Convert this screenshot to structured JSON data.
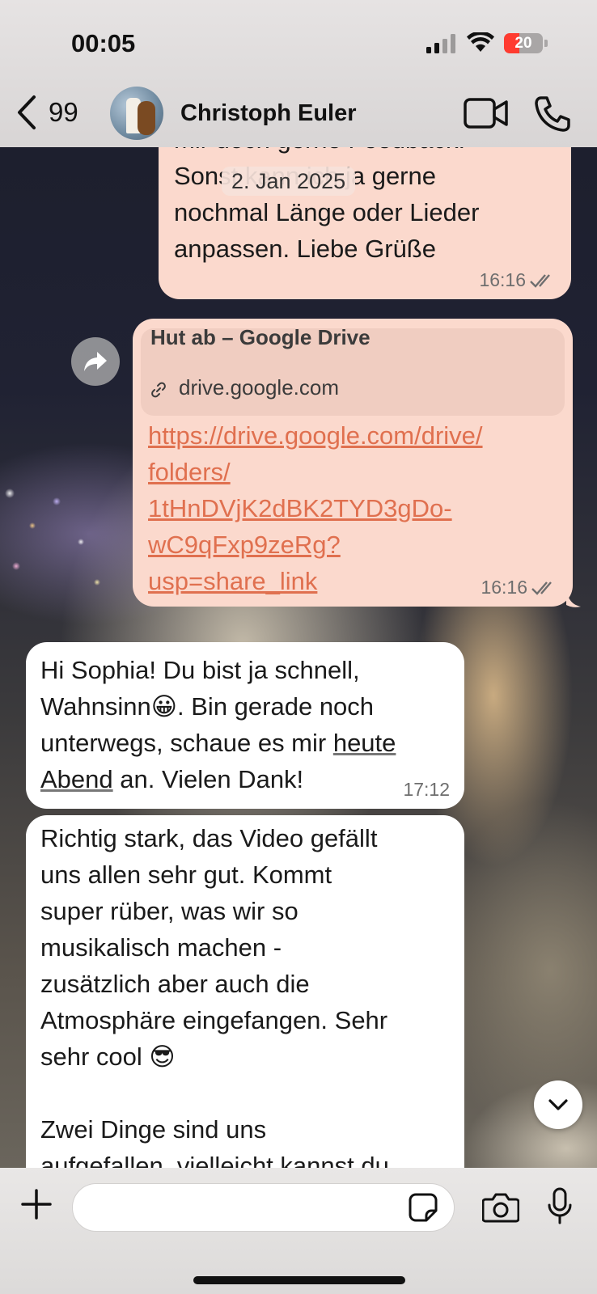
{
  "status_bar": {
    "time": "00:05",
    "battery": "20",
    "battery_color": "#ff3b30"
  },
  "header": {
    "back_count": "99",
    "contact_name": "Christoph Euler",
    "icons": [
      "back-chevron-icon",
      "avatar",
      "video-call-icon",
      "phone-call-icon"
    ]
  },
  "chat": {
    "date_chip": "2. Jan 2025",
    "messages": [
      {
        "direction": "out",
        "lines": [
          "mir doch gerne Feedback.",
          "Sonst kann ich ja gerne",
          "nochmal Länge oder Lieder",
          "anpassen. Liebe Grüße"
        ],
        "time": "16:16",
        "read": true
      },
      {
        "direction": "out",
        "link_preview_title": "Hut ab – Google Drive",
        "link_preview_host": "drive.google.com",
        "url_lines": [
          "https://drive.google.com/drive/",
          "folders/",
          "1tHnDVjK2dBK2TYD3gDo-",
          "wC9qFxp9zeRg?",
          "usp=share_link"
        ],
        "time": "16:16",
        "read": true
      },
      {
        "direction": "in",
        "line1": "Hi Sophia! Du bist ja schnell,",
        "line2_a": "Wahnsinn",
        "emoji_1": "😀",
        "line2_b": ". Bin gerade noch",
        "line3_a": "unterwegs, schaue es mir ",
        "line3_link": "heute",
        "line4_link": "Abend",
        "line4_b": " an. Vielen Dank!",
        "time": "17:12"
      },
      {
        "direction": "in",
        "lines": [
          "Richtig stark, das Video gefällt",
          "uns allen sehr gut. Kommt",
          "super rüber, was wir so",
          "musikalisch machen -",
          "zusätzlich aber auch die",
          "Atmosphäre eingefangen. Sehr"
        ],
        "line7": "sehr cool ",
        "emoji_2": "😎",
        "line8": "Zwei Dinge sind uns",
        "line9": "aufgefallen, vielleicht kannst du"
      }
    ]
  },
  "composer": {
    "value": "",
    "placeholder": ""
  },
  "colors": {
    "outgoing_bubble": "#fbd9cd",
    "incoming_bubble": "#ffffff",
    "link": "#e0704f"
  }
}
